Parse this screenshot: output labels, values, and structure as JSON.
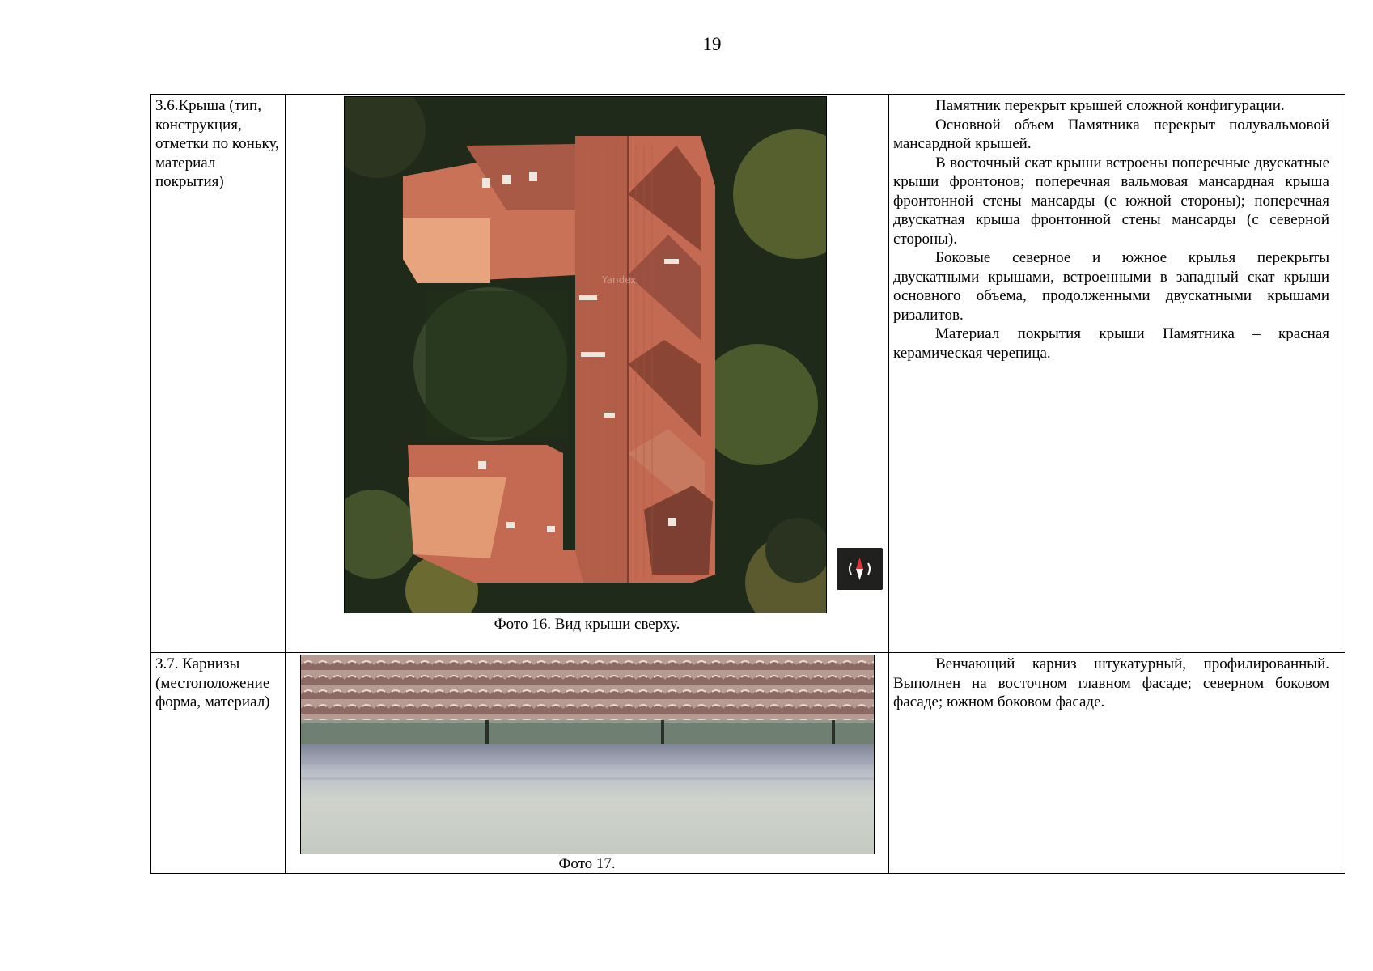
{
  "page": {
    "number": "19"
  },
  "rows": [
    {
      "label": "3.6.Крыша (тип, конструкция, отметки по коньку, материал покрытия)",
      "photo_caption": "Фото 16. Вид крыши сверху.",
      "photo_watermark": "Yandex",
      "paragraphs": [
        "Памятник перекрыт крышей сложной конфигурации.",
        "Основной объем Памятника перекрыт полувальмовой мансардной крышей.",
        "В восточный скат крыши встроены поперечные двускатные крыши фронтонов; поперечная вальмовая мансардная крыша фронтонной стены мансарды (с южной стороны); поперечная двускатная  крыша фронтонной стены мансарды (с северной стороны).",
        "Боковые северное и южное крылья перекрыты двускатными крышами, встроенными в западный скат крыши основного объема, продолженными двускатными крышами ризалитов.",
        "Материал покрытия крыши Памятника – красная керамическая черепица."
      ]
    },
    {
      "label": "3.7. Карнизы (местоположение форма, материал)",
      "photo_caption": "Фото 17.",
      "paragraphs": [
        "Венчающий карниз штукатурный, профилированный. Выполнен на восточном главном фасаде; северном боковом фасаде; южном боковом фасаде."
      ]
    }
  ],
  "compass": {
    "icon": "compass-icon"
  },
  "colors": {
    "roof": "#c8705a",
    "roof_shadow": "#8c4a3a",
    "trees": "#3d4a2a",
    "plaster": "#c9ccc4"
  }
}
